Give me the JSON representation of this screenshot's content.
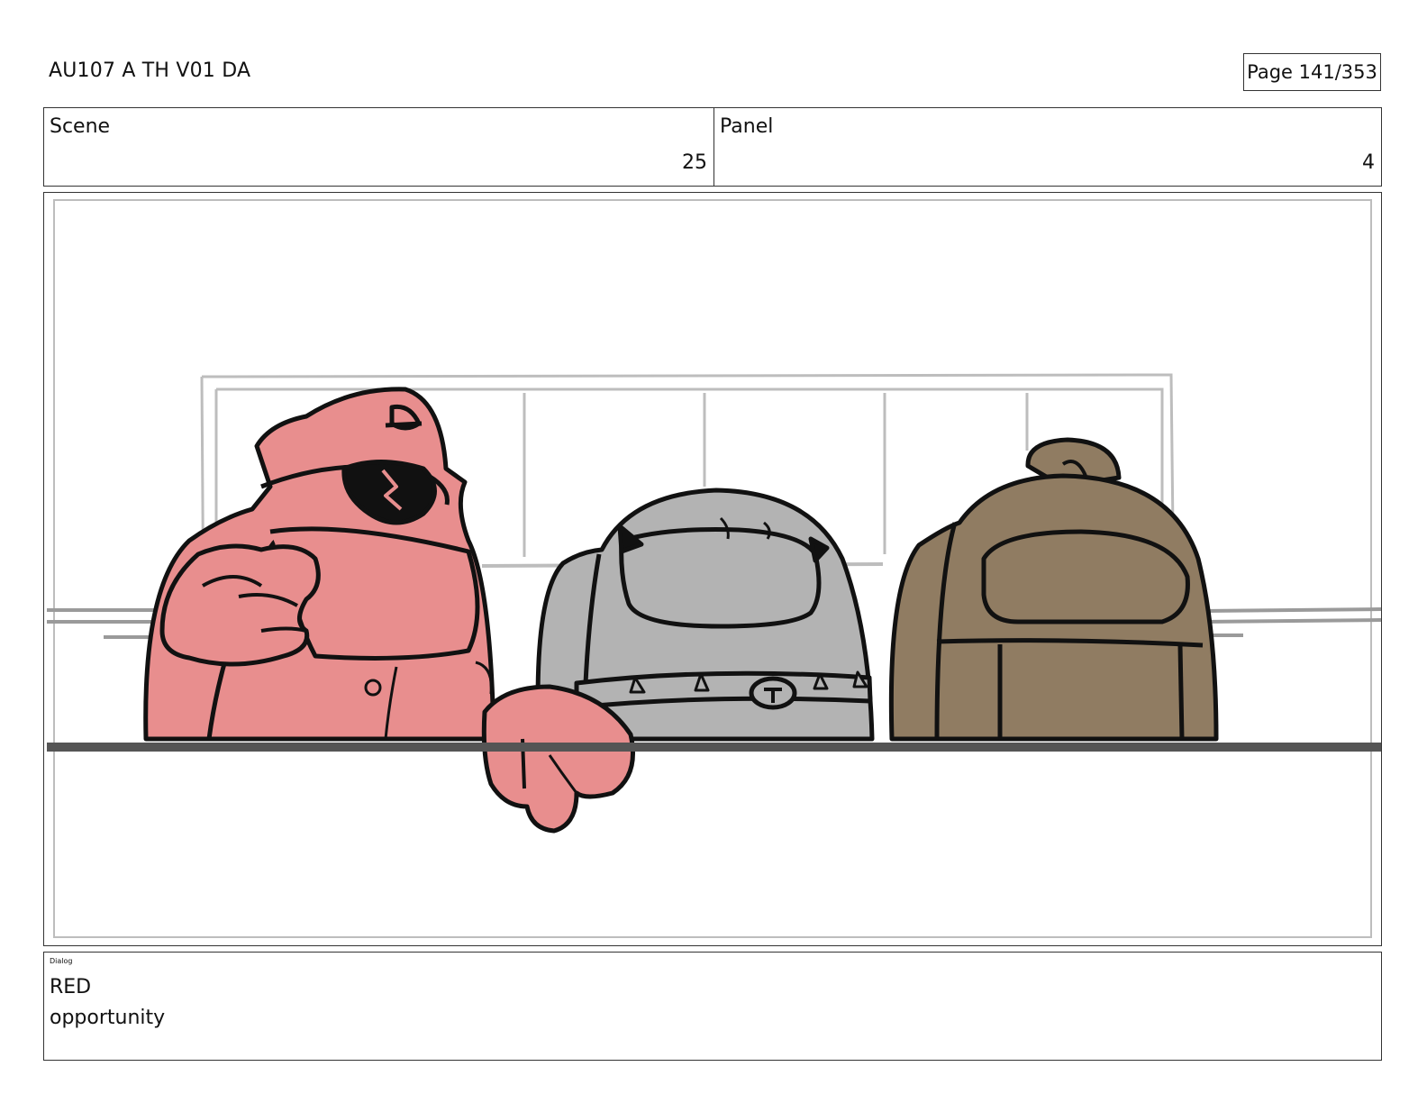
{
  "header": {
    "doc_id": "AU107 A TH V01 DA",
    "page": "Page 141/353"
  },
  "info": {
    "scene_label": "Scene",
    "scene_value": "25",
    "panel_label": "Panel",
    "panel_value": "4"
  },
  "artwork": {
    "characters": [
      {
        "name": "red-crewmate-icon",
        "color": "#e88e8e"
      },
      {
        "name": "gray-crewmate-icon",
        "color": "#b3b3b3"
      },
      {
        "name": "brown-crewmate-icon",
        "color": "#907c62"
      }
    ],
    "line_color": "#111111",
    "background_line_color": "#bdbdbd"
  },
  "dialog": {
    "label": "Dialog",
    "speaker": "RED",
    "line": "opportunity"
  }
}
